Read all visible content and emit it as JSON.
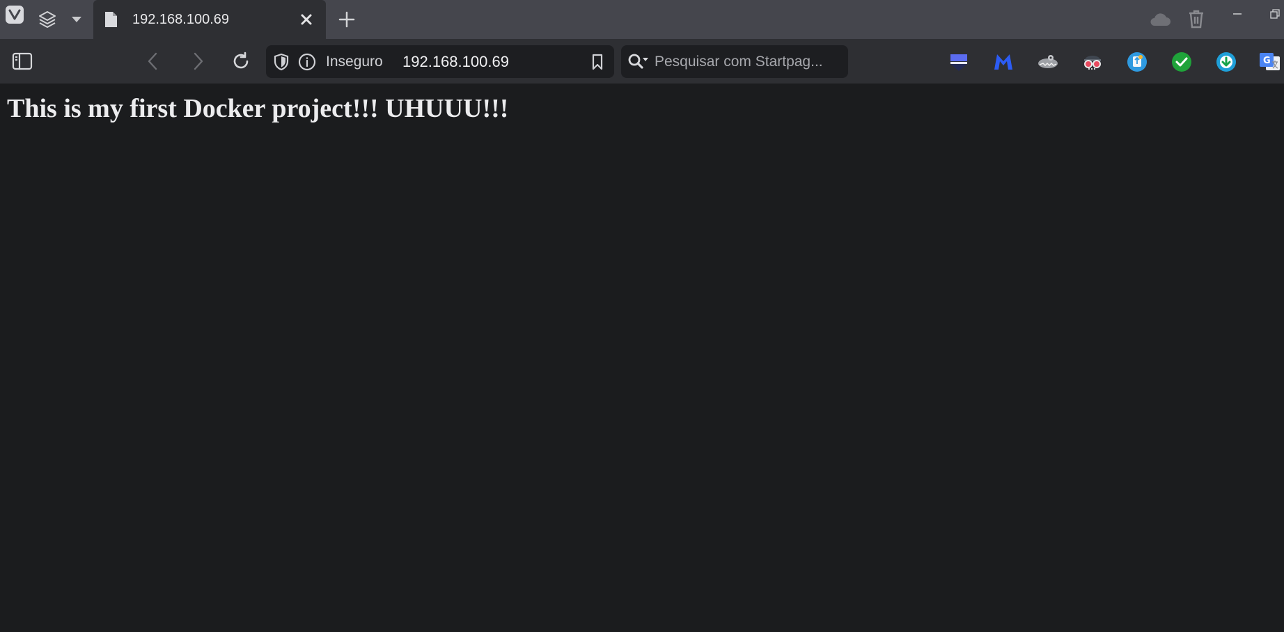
{
  "browser": {
    "tab": {
      "title": "192.168.100.69"
    },
    "address_bar": {
      "security_label": "Inseguro",
      "url": "192.168.100.69"
    },
    "search": {
      "placeholder": "Pesquisar com Startpag..."
    },
    "extensions": [
      "stackedit-icon",
      "malwarebytes-icon",
      "crocodile-extension-icon",
      "spy-glasses-icon",
      "recycle-bin-extension-icon",
      "checkmark-extension-icon",
      "download-extension-icon",
      "google-translate-icon"
    ],
    "colors": {
      "tabbar": "#45464d",
      "toolbar": "#2e2f33",
      "page_background": "#1b1c1e",
      "page_text": "#ececee"
    }
  },
  "page": {
    "heading": "This is my first Docker project!!! UHUUU!!!"
  }
}
